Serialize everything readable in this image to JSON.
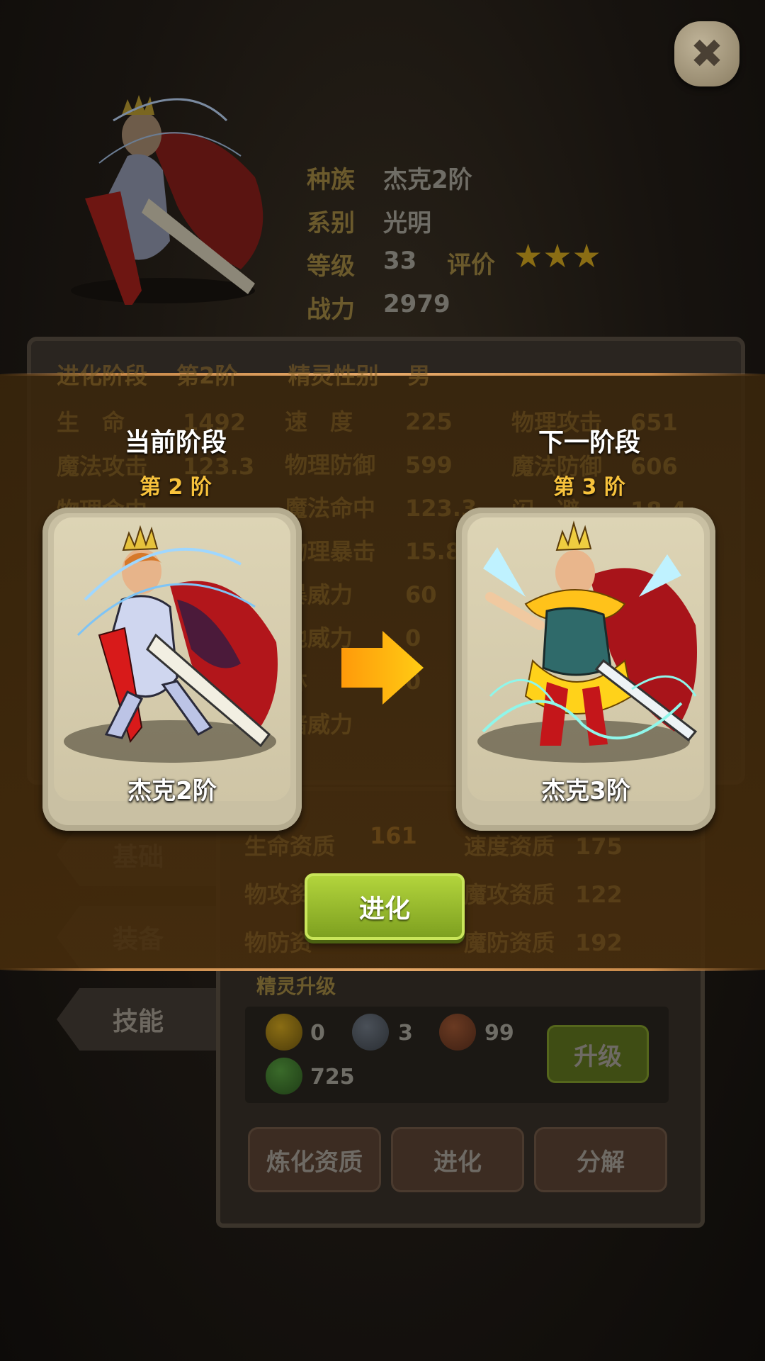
{
  "profile": {
    "labels": {
      "race": "种族",
      "type": "系别",
      "level": "等级",
      "rating": "评价",
      "power": "战力"
    },
    "race": "杰克2阶",
    "type": "光明",
    "level": "33",
    "power": "2979",
    "rating_stars": 3
  },
  "stats_panel": {
    "evolve_stage_label": "进化阶段",
    "evolve_stage_value": "第2阶",
    "gender_label": "精灵性别",
    "gender_value": "男",
    "rows": [
      {
        "a_label": "生　命",
        "a_val": "1492",
        "b_label": "速　度",
        "b_val": "225",
        "c_label": "物理攻击",
        "c_val": "651"
      },
      {
        "a_label": "魔法攻击",
        "a_val": "",
        "b_label": "物理防御",
        "b_val": "599",
        "c_label": "魔法防御",
        "c_val": "606"
      },
      {
        "a_label": "物理命中",
        "a_val": "123.3",
        "b_label": "魔法命中",
        "b_val": "123.3",
        "c_label": "闪　避",
        "c_val": "18.4"
      },
      {
        "a_label": "",
        "a_val": "",
        "b_label": "物理暴击",
        "b_val": "15.8",
        "c_label": "",
        "c_val": ""
      },
      {
        "a_label": "",
        "a_val": "",
        "b_label": "暴威力",
        "b_val": "60",
        "c_label": "",
        "c_val": ""
      },
      {
        "a_label": "",
        "a_val": "",
        "b_label": "地威力",
        "b_val": "0",
        "c_label": "",
        "c_val": ""
      },
      {
        "a_label": "",
        "a_val": "",
        "b_label": "林",
        "b_val": "",
        "c_label": "",
        "c_val": ""
      },
      {
        "a_label": "",
        "a_val": "",
        "b_label": "暗威力",
        "b_val": "0",
        "c_label": "",
        "c_val": ""
      }
    ]
  },
  "side_tabs": [
    "基础",
    "装备",
    "技能"
  ],
  "aptitude": {
    "life_label": "生命资质",
    "life_val": "161",
    "speed_label": "速度资质",
    "speed_val": "175",
    "patk_label": "物攻资",
    "matk_label": "魔攻资质",
    "matk_val": "122",
    "pdef_label": "物防资",
    "mdef_label": "魔防资质",
    "mdef_val": "192"
  },
  "upgrade": {
    "title": "精灵升级",
    "gold": "0",
    "silver": "3",
    "bronze": "99",
    "clover": "725",
    "button": "升级"
  },
  "bottom_buttons": [
    "炼化资质",
    "进化",
    "分解"
  ],
  "evolve_dialog": {
    "current_title": "当前阶段",
    "current_stage": "第 2 阶",
    "current_name": "杰克2阶",
    "next_title": "下一阶段",
    "next_stage": "第 3 阶",
    "next_name": "杰克3阶",
    "button": "进化"
  },
  "colors": {
    "accent_gold": "#f7c23c",
    "evolve_green": "#9cc22e",
    "band_brown": "#4a3010"
  },
  "icons": {
    "close": "close-icon",
    "arrow": "arrow-right-icon"
  }
}
